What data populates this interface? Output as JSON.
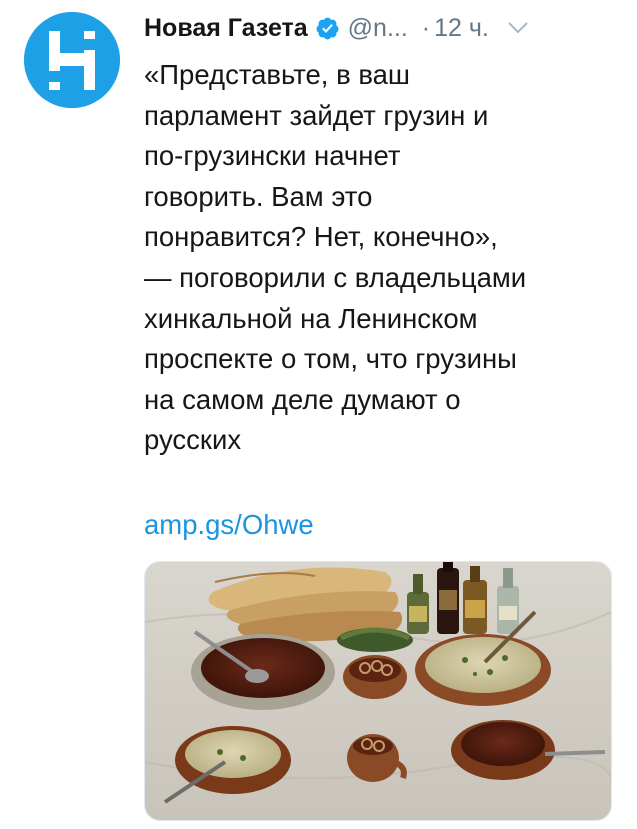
{
  "tweet": {
    "author_name": "Новая Газета",
    "verified_icon": "verified-badge-icon",
    "handle": "@n...",
    "separator": "·",
    "time": "12 ч.",
    "menu_icon": "chevron-down-icon",
    "text_lines": [
      "«Представьте, в ваш",
      "парламент зайдет грузин и",
      "по-грузински начнет",
      "говорить. Вам это",
      "понравится? Нет, конечно»,",
      "— поговорили с владельцами",
      "хинкальной на Ленинском",
      "проспекте о том, что грузины",
      "на самом деле думают о",
      "русских"
    ],
    "link": "amp.gs/Ohwe",
    "media_icon": "food-photo"
  },
  "colors": {
    "accent": "#1b95e0",
    "avatar_bg": "#1ea0e6",
    "muted": "#657786",
    "text": "#14171a"
  }
}
